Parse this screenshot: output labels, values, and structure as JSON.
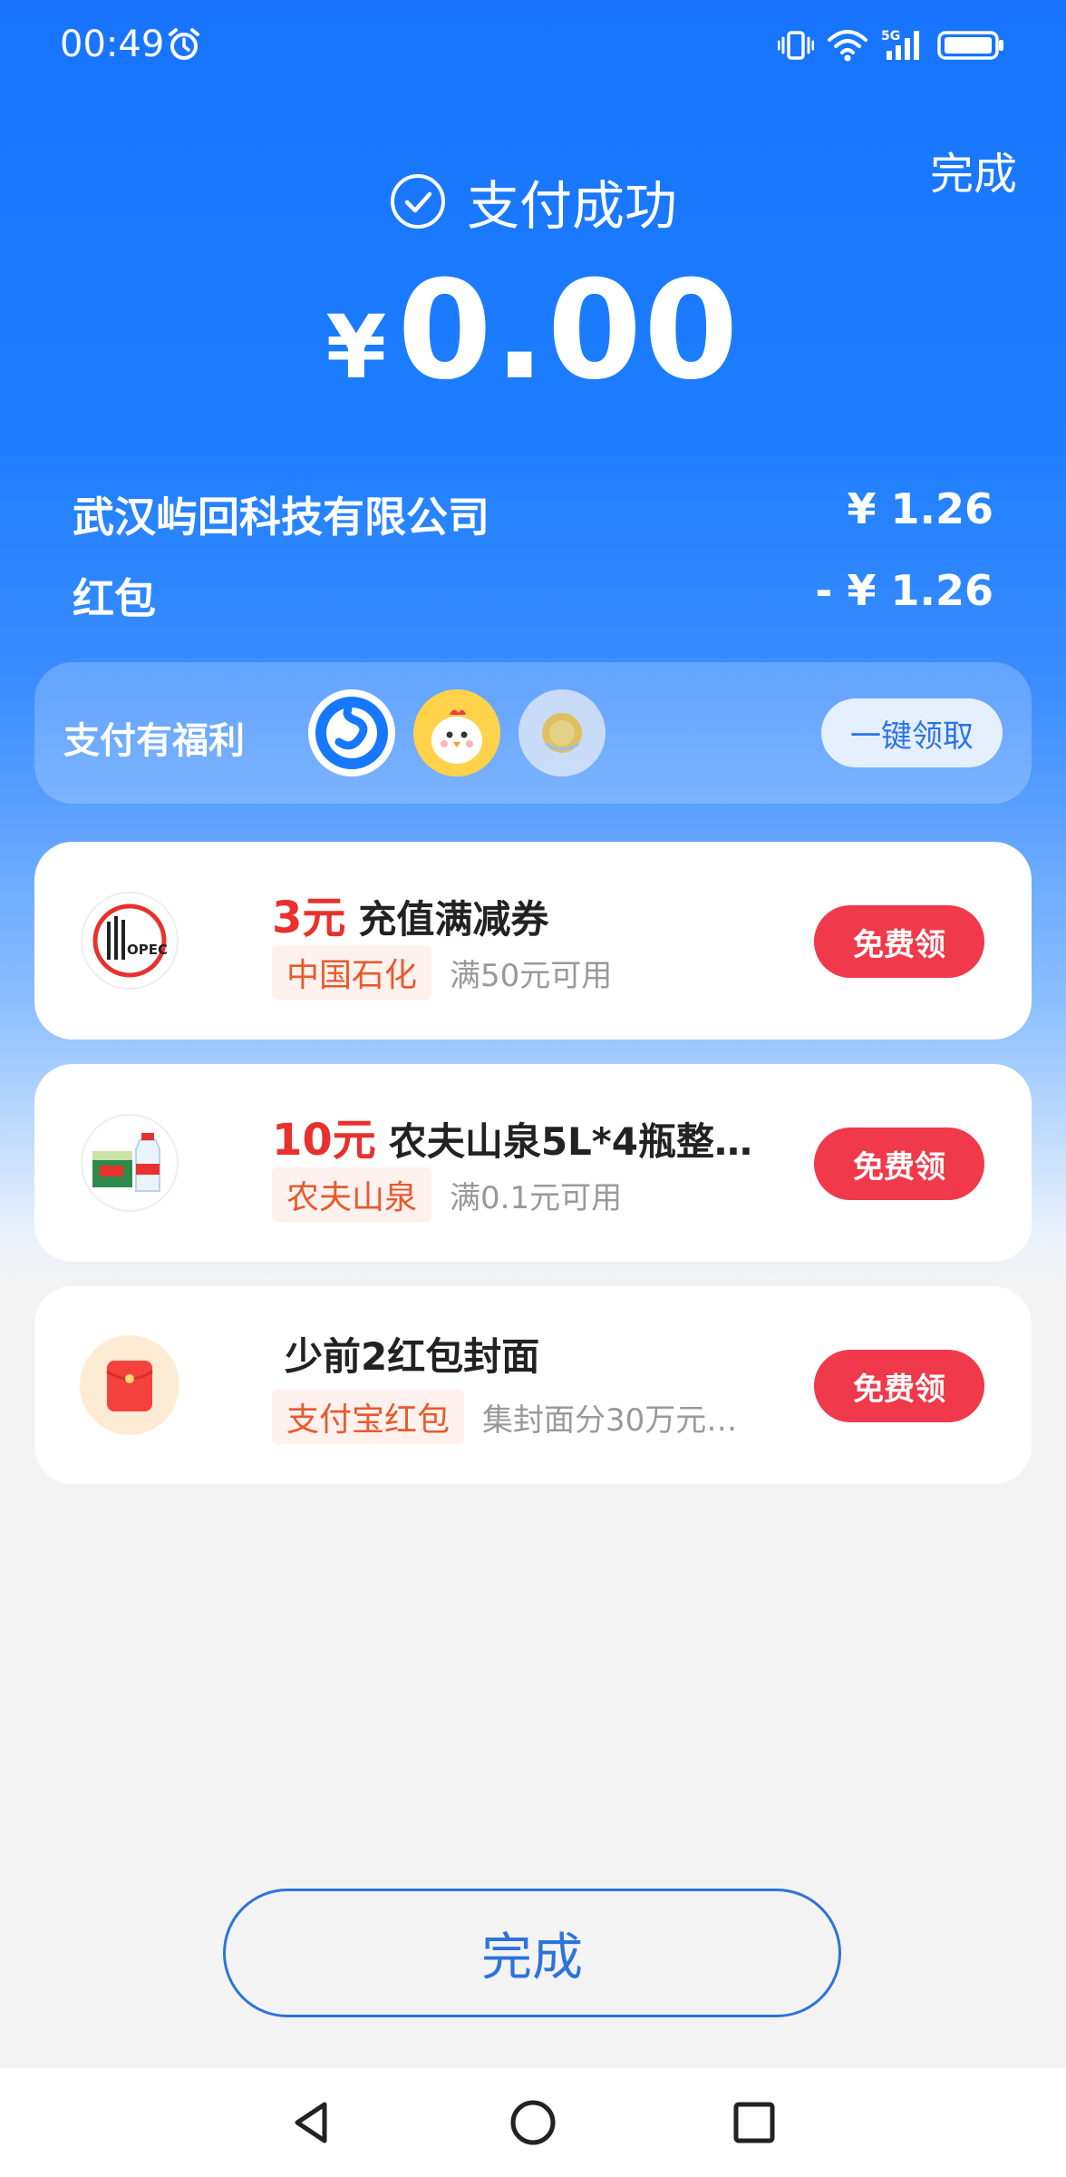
{
  "status_bar": {
    "time": "00:49"
  },
  "header": {
    "done_label": "完成",
    "success_label": "支付成功",
    "currency": "¥",
    "amount": "0.00"
  },
  "details": {
    "merchant_name": "武汉屿回科技有限公司",
    "merchant_amount": "¥ 1.26",
    "redpacket_label": "红包",
    "redpacket_amount": "- ¥ 1.26"
  },
  "benefits": {
    "title": "支付有福利",
    "claim_all_label": "一键领取"
  },
  "coupons": [
    {
      "price": "3元",
      "title": "充值满减券",
      "tag": "中国石化",
      "condition": "满50元可用",
      "claim_label": "免费领"
    },
    {
      "price": "10元",
      "title": "农夫山泉5L*4瓶整…",
      "tag": "农夫山泉",
      "condition": "满0.1元可用",
      "claim_label": "免费领"
    },
    {
      "price": "",
      "title": "少前2红包封面",
      "tag": "支付宝红包",
      "condition": "集封面分30万元…",
      "claim_label": "免费领"
    }
  ],
  "footer": {
    "done_label": "完成"
  },
  "colors": {
    "brand_blue": "#1874ff",
    "claim_red": "#f0394b",
    "price_red": "#e8312d"
  }
}
